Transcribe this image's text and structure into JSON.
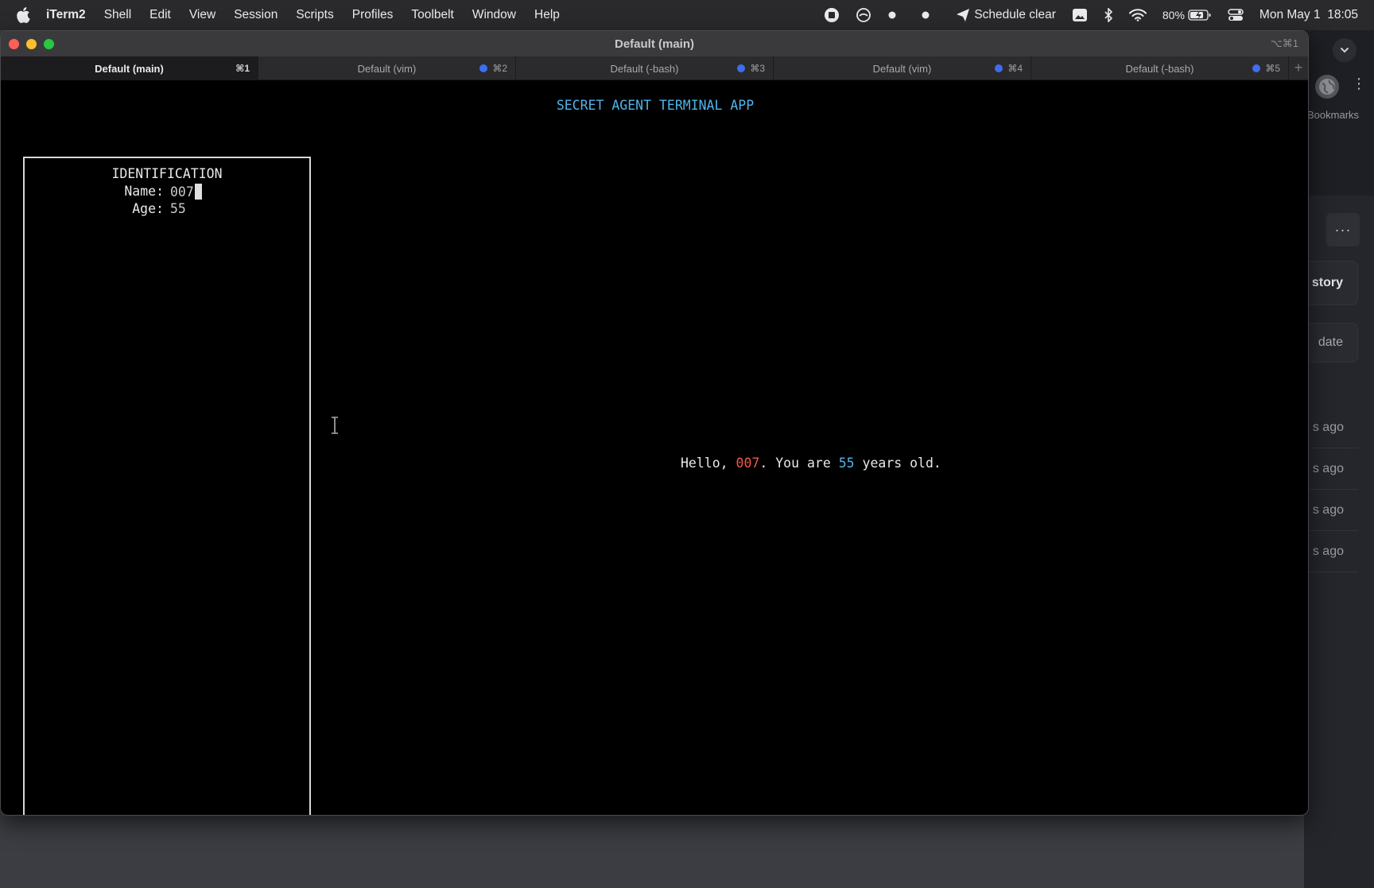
{
  "menubar": {
    "items": [
      "iTerm2",
      "Shell",
      "Edit",
      "View",
      "Session",
      "Scripts",
      "Profiles",
      "Toolbelt",
      "Window",
      "Help"
    ],
    "status": {
      "schedule_label": "Schedule clear",
      "battery": "80%",
      "datetime": "Mon May 1  18:05"
    }
  },
  "window": {
    "title": "Default (main)",
    "title_shortcut": "⌥⌘1",
    "tabs": [
      {
        "label": "Default (main)",
        "key": "⌘1",
        "active": true
      },
      {
        "label": "Default (vim)",
        "key": "⌘2",
        "active": false
      },
      {
        "label": "Default (-bash)",
        "key": "⌘3",
        "active": false
      },
      {
        "label": "Default (vim)",
        "key": "⌘4",
        "active": false
      },
      {
        "label": "Default (-bash)",
        "key": "⌘5",
        "active": false
      }
    ],
    "add_tab": "+"
  },
  "terminal": {
    "app_title": "SECRET AGENT TERMINAL APP",
    "panel": {
      "heading": "IDENTIFICATION",
      "name_label": "Name:",
      "name_value": "007",
      "age_label": "Age:",
      "age_value": "55"
    },
    "greeting": {
      "prefix": "Hello, ",
      "name": "007",
      "middle": ". You are ",
      "age": "55",
      "suffix": " years old."
    }
  },
  "background_app": {
    "bookmarks_label": "Bookmarks",
    "more_label": "···",
    "history_label": "story",
    "date_label": "date",
    "ago_items": [
      "s ago",
      "s ago",
      "s ago",
      "s ago"
    ]
  },
  "colors": {
    "accent_blue": "#4fb4ea",
    "accent_red": "#ef5a4f",
    "tab_dot": "#3d6ef0"
  }
}
